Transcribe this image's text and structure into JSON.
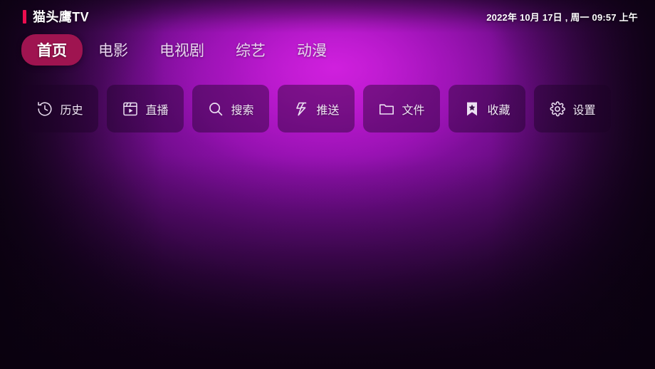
{
  "header": {
    "brand_name": "猫头鹰TV",
    "brand_accent_color": "#ec0d4f",
    "datetime": "2022年 10月 17日 , 周一 09:57 上午"
  },
  "nav": {
    "active_index": 0,
    "active_pill_color": "#9f1450",
    "tabs": [
      {
        "label": "首页",
        "active": true
      },
      {
        "label": "电影",
        "active": false
      },
      {
        "label": "电视剧",
        "active": false
      },
      {
        "label": "综艺",
        "active": false
      },
      {
        "label": "动漫",
        "active": false
      }
    ]
  },
  "shortcuts": {
    "tiles": [
      {
        "label": "历史",
        "icon": "history-clock-icon"
      },
      {
        "label": "直播",
        "icon": "live-play-frame-icon"
      },
      {
        "label": "搜索",
        "icon": "search-icon"
      },
      {
        "label": "推送",
        "icon": "lightning-bolt-icon"
      },
      {
        "label": "文件",
        "icon": "folder-icon"
      },
      {
        "label": "收藏",
        "icon": "bookmark-star-icon"
      },
      {
        "label": "设置",
        "icon": "gear-icon"
      }
    ]
  },
  "theme": {
    "background_center": "#b215c8",
    "background_edge": "#170220",
    "text_primary": "#ffffff",
    "text_secondary": "#e9d6ef",
    "tile_fill": "rgba(26,3,35,0.42)"
  }
}
